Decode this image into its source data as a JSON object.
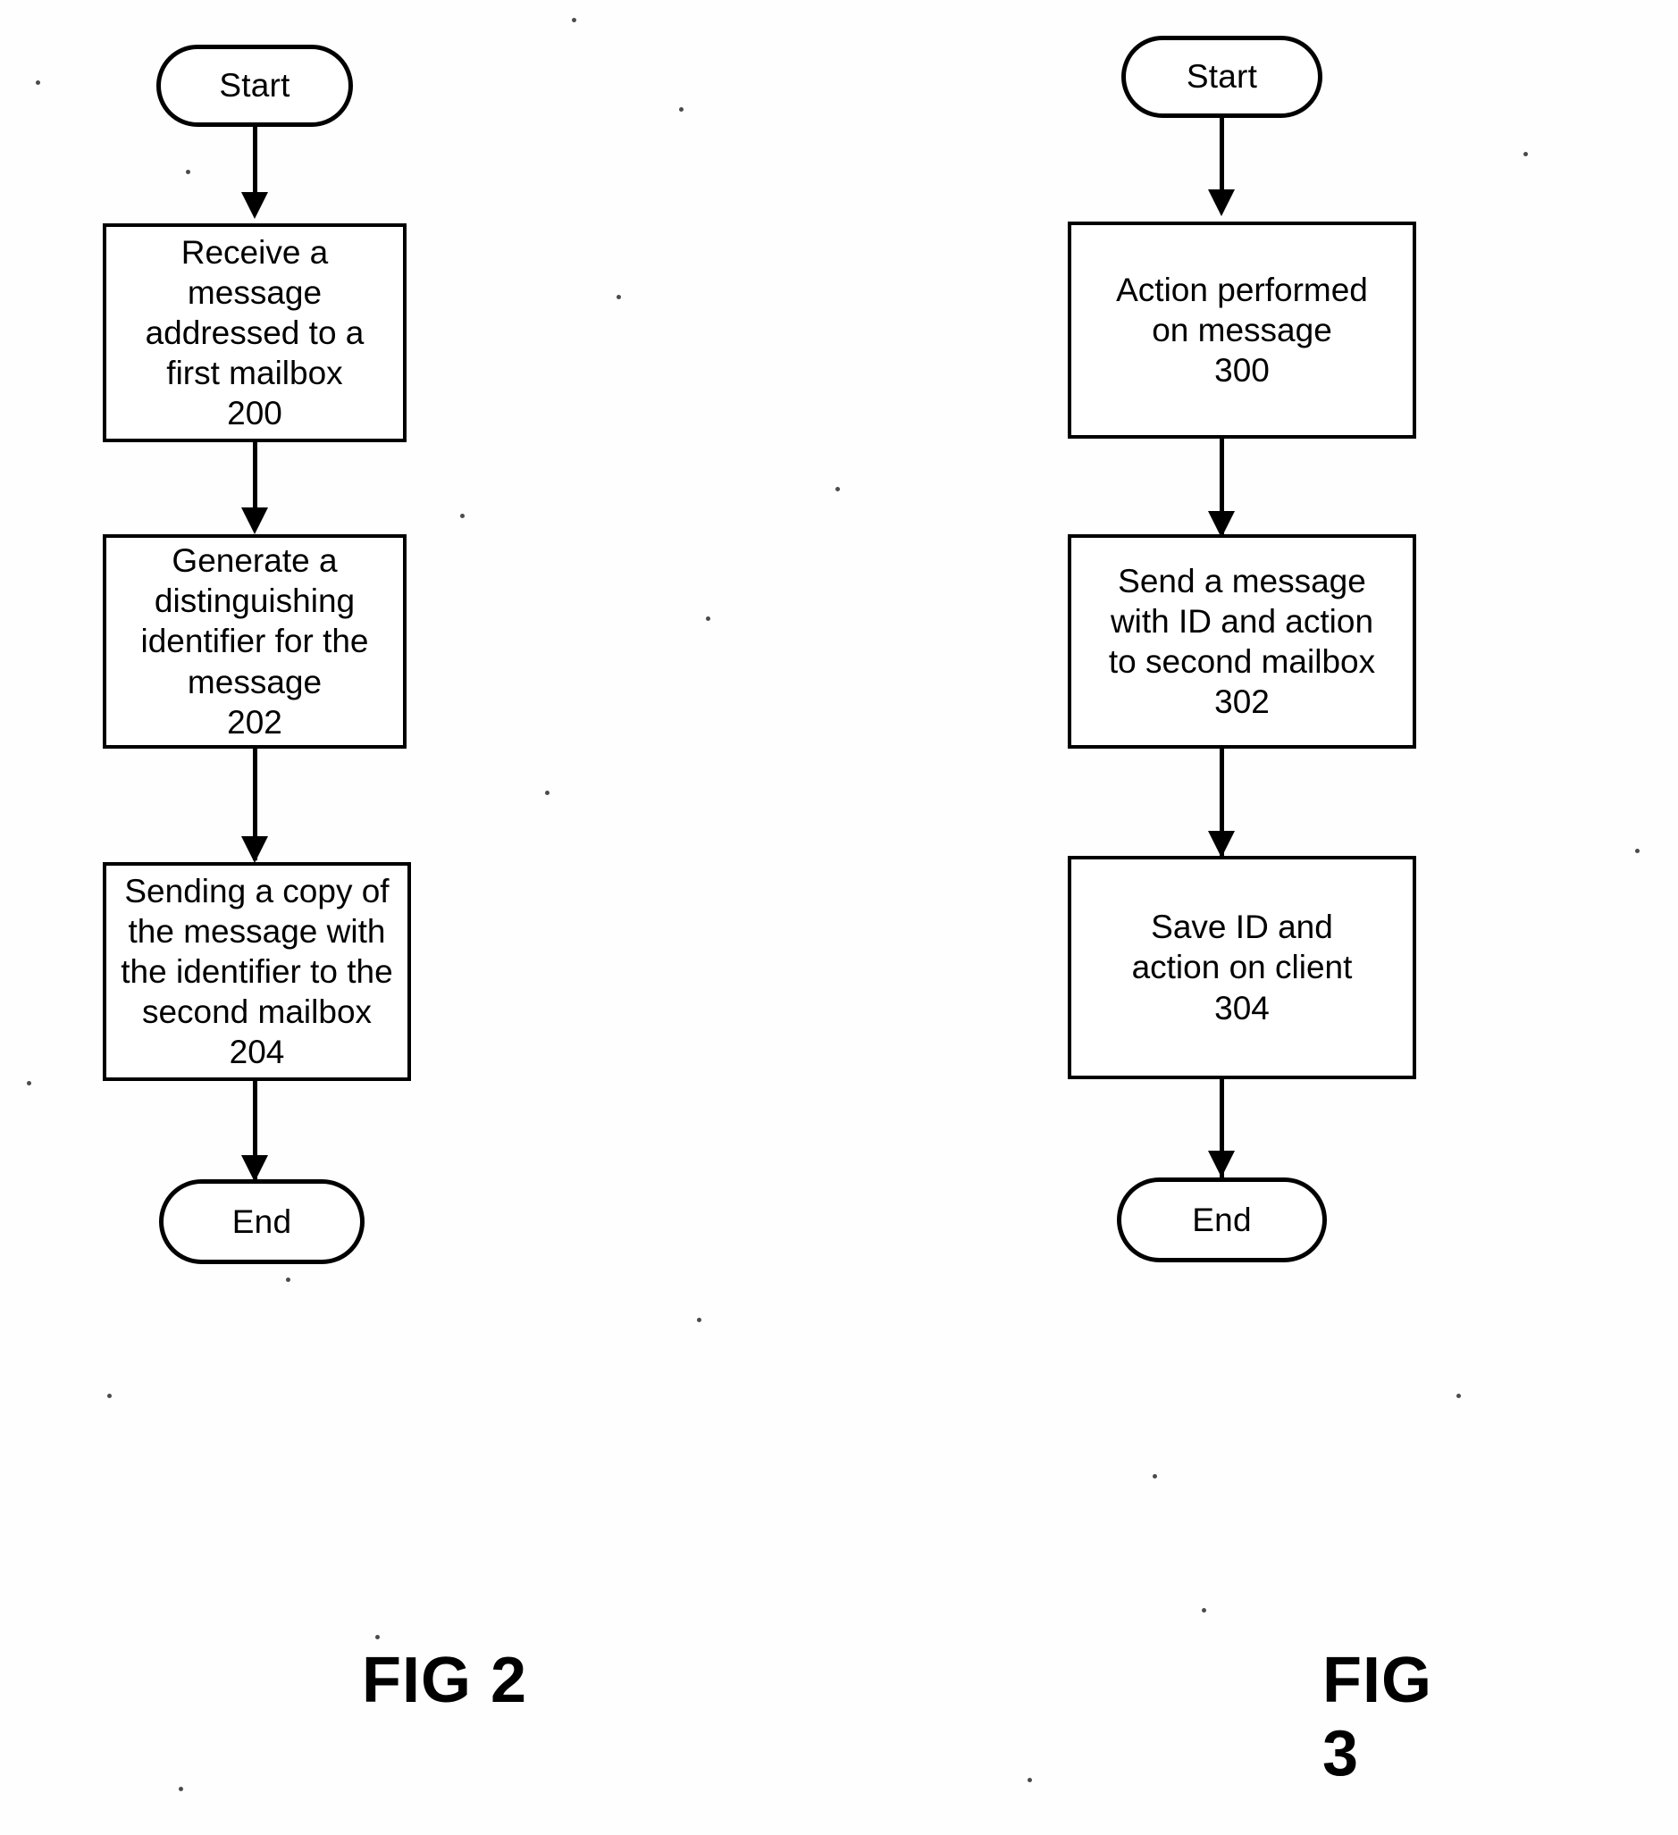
{
  "document": {
    "title": "Patent drawing sheet — FIG 2 and FIG 3 flowcharts",
    "ink_color": "#000000",
    "paper_color": "#ffffff"
  },
  "figures": [
    {
      "caption": "FIG 2",
      "nodes": [
        {
          "id": "fig2-start",
          "shape": "terminator",
          "label": "Start"
        },
        {
          "id": "fig2-step1",
          "shape": "process",
          "label": "Receive a\nmessage\naddressed to a\nfirst mailbox\n200",
          "ref": "200"
        },
        {
          "id": "fig2-step2",
          "shape": "process",
          "label": "Generate a\ndistinguishing\nidentifier for the\nmessage\n202",
          "ref": "202"
        },
        {
          "id": "fig2-step3",
          "shape": "process",
          "label": "Sending a copy of\nthe message with\nthe identifier to the\nsecond mailbox\n204",
          "ref": "204"
        },
        {
          "id": "fig2-end",
          "shape": "terminator",
          "label": "End"
        }
      ]
    },
    {
      "caption": "FIG 3",
      "nodes": [
        {
          "id": "fig3-start",
          "shape": "terminator",
          "label": "Start"
        },
        {
          "id": "fig3-step1",
          "shape": "process",
          "label": "Action performed\non message\n300",
          "ref": "300"
        },
        {
          "id": "fig3-step2",
          "shape": "process",
          "label": "Send a message\nwith ID and action\nto second mailbox\n302",
          "ref": "302"
        },
        {
          "id": "fig3-step3",
          "shape": "process",
          "label": "Save ID and\naction on client\n304",
          "ref": "304"
        },
        {
          "id": "fig3-end",
          "shape": "terminator",
          "label": "End"
        }
      ]
    }
  ]
}
